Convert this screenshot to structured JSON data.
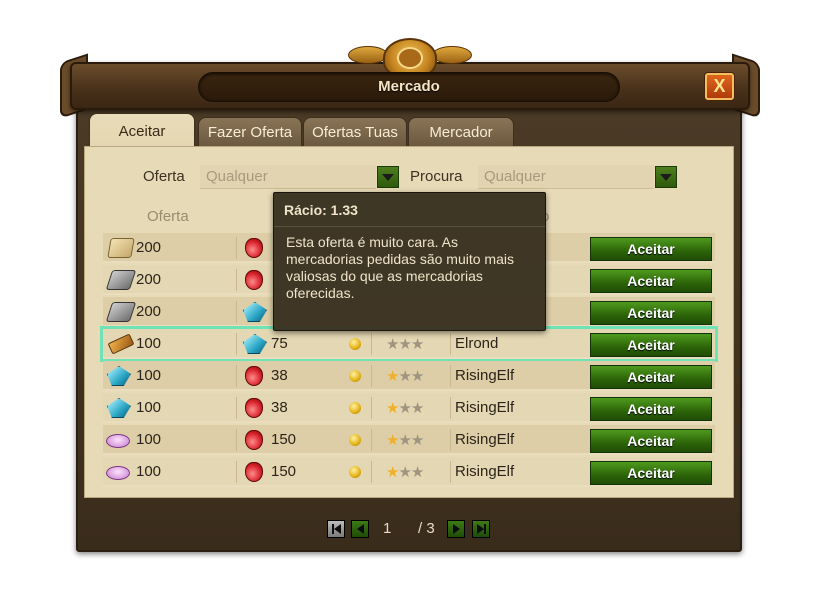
{
  "window": {
    "title": "Mercado",
    "close_label": "X"
  },
  "tabs": [
    {
      "label": "Aceitar",
      "active": true
    },
    {
      "label": "Fazer Oferta",
      "active": false
    },
    {
      "label": "Ofertas Tuas",
      "active": false
    },
    {
      "label": "Mercador",
      "active": false
    }
  ],
  "filters": {
    "offer_label": "Oferta",
    "offer_value": "Qualquer",
    "request_label": "Procura",
    "request_value": "Qualquer"
  },
  "columns": {
    "offer": "Oferta",
    "request_partial": "o"
  },
  "rows": [
    {
      "offer_icon": "marble-icon",
      "offer_qty": "200",
      "request_icon": "elixir-icon",
      "request_qty": "",
      "rating": 0,
      "player": "",
      "action": "Aceitar"
    },
    {
      "offer_icon": "steel-icon",
      "offer_qty": "200",
      "request_icon": "elixir-icon",
      "request_qty": "",
      "rating": 0,
      "player": "",
      "action": "Aceitar"
    },
    {
      "offer_icon": "steel-icon",
      "offer_qty": "200",
      "request_icon": "crystal-icon",
      "request_qty": "",
      "rating": 0,
      "player": "",
      "action": "Aceitar"
    },
    {
      "offer_icon": "plank-icon",
      "offer_qty": "100",
      "request_icon": "crystal-icon",
      "request_qty": "75",
      "rating": 0,
      "player": "Elrond",
      "action": "Aceitar",
      "highlight": true
    },
    {
      "offer_icon": "crystal-icon",
      "offer_qty": "100",
      "request_icon": "elixir-icon",
      "request_qty": "38",
      "rating": 1,
      "player": "RisingElf",
      "action": "Aceitar"
    },
    {
      "offer_icon": "crystal-icon",
      "offer_qty": "100",
      "request_icon": "elixir-icon",
      "request_qty": "38",
      "rating": 1,
      "player": "RisingElf",
      "action": "Aceitar"
    },
    {
      "offer_icon": "silk-icon",
      "offer_qty": "100",
      "request_icon": "elixir-icon",
      "request_qty": "150",
      "rating": 1,
      "player": "RisingElf",
      "action": "Aceitar"
    },
    {
      "offer_icon": "silk-icon",
      "offer_qty": "100",
      "request_icon": "elixir-icon",
      "request_qty": "150",
      "rating": 1,
      "player": "RisingElf",
      "action": "Aceitar"
    }
  ],
  "tooltip": {
    "title": "Rácio: 1.33",
    "body": "Esta oferta é muito cara. As mercadorias pedidas são muito mais valiosas do que as mercadorias oferecidas."
  },
  "pagination": {
    "current": "1",
    "total": "/ 3"
  },
  "colors": {
    "accept_green": "#2c6409",
    "highlight": "#6fe3b5",
    "parchment": "#e7dab7"
  }
}
